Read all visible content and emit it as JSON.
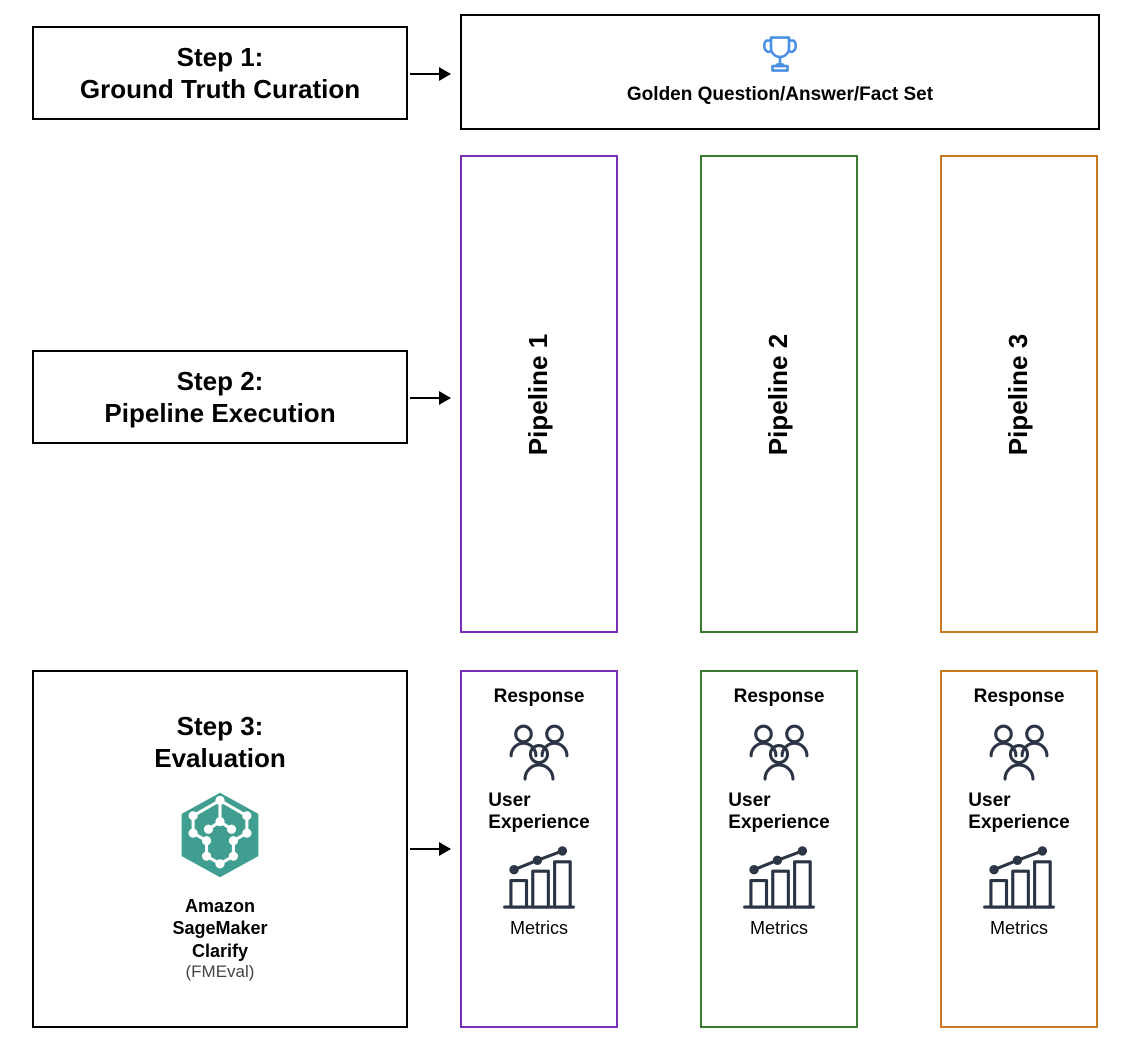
{
  "step1": {
    "title": "Step 1:",
    "subtitle": "Ground Truth Curation",
    "output_label": "Golden Question/Answer/Fact Set"
  },
  "step2": {
    "title": "Step 2:",
    "subtitle": "Pipeline Execution",
    "pipelines": [
      "Pipeline 1",
      "Pipeline 2",
      "Pipeline 3"
    ]
  },
  "step3": {
    "title": "Step 3:",
    "subtitle": "Evaluation",
    "tool_name": "Amazon SageMaker Clarify",
    "tool_sub": "(FMEval)"
  },
  "eval_block": {
    "response": "Response",
    "ux": "User Experience",
    "metrics": "Metrics"
  },
  "colors": {
    "purple": "#7a2eb8",
    "green": "#3a7a2e",
    "orange": "#c87a1e",
    "darknavy": "#2a3445",
    "teal": "#3f9e8f",
    "trophy": "#4a90e2"
  }
}
